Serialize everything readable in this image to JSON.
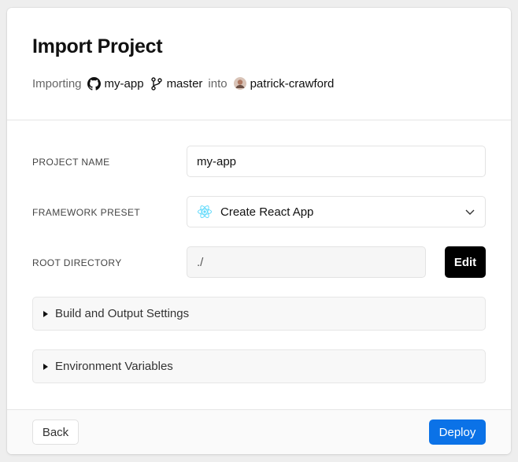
{
  "header": {
    "title": "Import Project",
    "importing_text": "Importing",
    "repo_name": "my-app",
    "branch": "master",
    "into_text": "into",
    "owner": "patrick-crawford"
  },
  "form": {
    "project_name_label": "PROJECT NAME",
    "project_name_value": "my-app",
    "framework_label": "FRAMEWORK PRESET",
    "framework_value": "Create React App",
    "root_label": "ROOT DIRECTORY",
    "root_value": "./",
    "edit_label": "Edit"
  },
  "sections": {
    "build_label": "Build and Output Settings",
    "env_label": "Environment Variables"
  },
  "footer": {
    "back_label": "Back",
    "deploy_label": "Deploy"
  },
  "colors": {
    "accent": "#0b72e7",
    "react": "#61dafb"
  },
  "icons": {
    "repo": "github-icon",
    "branch": "git-branch-icon",
    "owner": "avatar",
    "framework": "react-icon",
    "dropdown": "chevron-down-icon",
    "collapse": "triangle-right-icon"
  }
}
